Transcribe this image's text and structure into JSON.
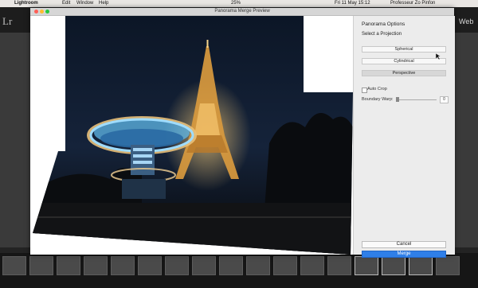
{
  "menubar": {
    "app": "Lightroom",
    "items": [
      "Edit",
      "Window",
      "Help"
    ],
    "clock": "Fri 11 May 15:12",
    "user": "Professeur Zo Pinfon",
    "battery": "25%"
  },
  "lightroom": {
    "logo": "Lr",
    "module_right": "Web"
  },
  "dialog": {
    "title": "Panorama Merge Preview",
    "options_title": "Panorama Options",
    "projection_label": "Select a Projection",
    "projections": [
      "Spherical",
      "Cylindrical",
      "Perspective"
    ],
    "selected_projection": "Perspective",
    "auto_crop_label": "Auto Crop",
    "auto_crop_checked": false,
    "boundary_warp_label": "Boundary Warp:",
    "boundary_warp_value": "0",
    "cancel_label": "Cancel",
    "merge_label": "Merge"
  },
  "colors": {
    "merge_button": "#2f7fe8",
    "sky": "#0e1a2c",
    "tower_lights": "#e8a640",
    "carousel": "#8fd3ff"
  },
  "icons": [
    "apple-icon",
    "close-button-icon",
    "minimize-button-icon",
    "zoom-button-icon",
    "cursor-icon"
  ]
}
